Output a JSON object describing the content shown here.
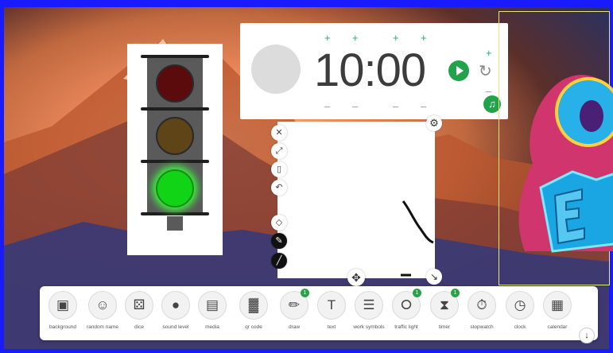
{
  "colors": {
    "frame_border": "#1a1aff",
    "accent_green": "#20a34a",
    "traffic_green": "#11d416"
  },
  "traffic_light": {
    "active": "green"
  },
  "timer": {
    "display": "10:00",
    "plus": "+",
    "minus": "–",
    "reset_glyph": "↻",
    "music_glyph": "♫"
  },
  "draw_panel": {
    "tools": [
      {
        "name": "close-icon",
        "glyph": "✕"
      },
      {
        "name": "expand-icon",
        "glyph": "⤢"
      },
      {
        "name": "delete-icon",
        "glyph": "▯"
      },
      {
        "name": "undo-icon",
        "glyph": "↶"
      },
      {
        "name": "eraser-icon",
        "glyph": "◇"
      },
      {
        "name": "pen-icon",
        "glyph": "✎"
      },
      {
        "name": "line-icon",
        "glyph": "╱"
      }
    ],
    "gear_glyph": "⚙",
    "move_glyph": "✥",
    "resize_glyph": "↘"
  },
  "toolbar": {
    "items": [
      {
        "label": "background",
        "icon": "image-icon",
        "glyph": "▣",
        "badge": ""
      },
      {
        "label": "random name",
        "icon": "person-icon",
        "glyph": "☺",
        "badge": ""
      },
      {
        "label": "dice",
        "icon": "dice-icon",
        "glyph": "⚄",
        "badge": ""
      },
      {
        "label": "sound level",
        "icon": "microphone-icon",
        "glyph": "●",
        "badge": ""
      },
      {
        "label": "media",
        "icon": "media-icon",
        "glyph": "▤",
        "badge": ""
      },
      {
        "label": "qr code",
        "icon": "qr-code-icon",
        "glyph": "▓",
        "badge": ""
      },
      {
        "label": "draw",
        "icon": "pencil-icon",
        "glyph": "✏",
        "badge": "1"
      },
      {
        "label": "text",
        "icon": "text-icon",
        "glyph": "T",
        "badge": ""
      },
      {
        "label": "work symbols",
        "icon": "work-symbols-icon",
        "glyph": "☰",
        "badge": ""
      },
      {
        "label": "traffic light",
        "icon": "traffic-light-icon",
        "glyph": "⭘",
        "badge": "1"
      },
      {
        "label": "timer",
        "icon": "hourglass-icon",
        "glyph": "⧗",
        "badge": "1"
      },
      {
        "label": "stopwatch",
        "icon": "stopwatch-icon",
        "glyph": "⏱",
        "badge": ""
      },
      {
        "label": "clock",
        "icon": "clock-icon",
        "glyph": "◷",
        "badge": ""
      },
      {
        "label": "calendar",
        "icon": "calendar-icon",
        "glyph": "▦",
        "badge": ""
      }
    ],
    "scroll_glyph": "↓"
  }
}
